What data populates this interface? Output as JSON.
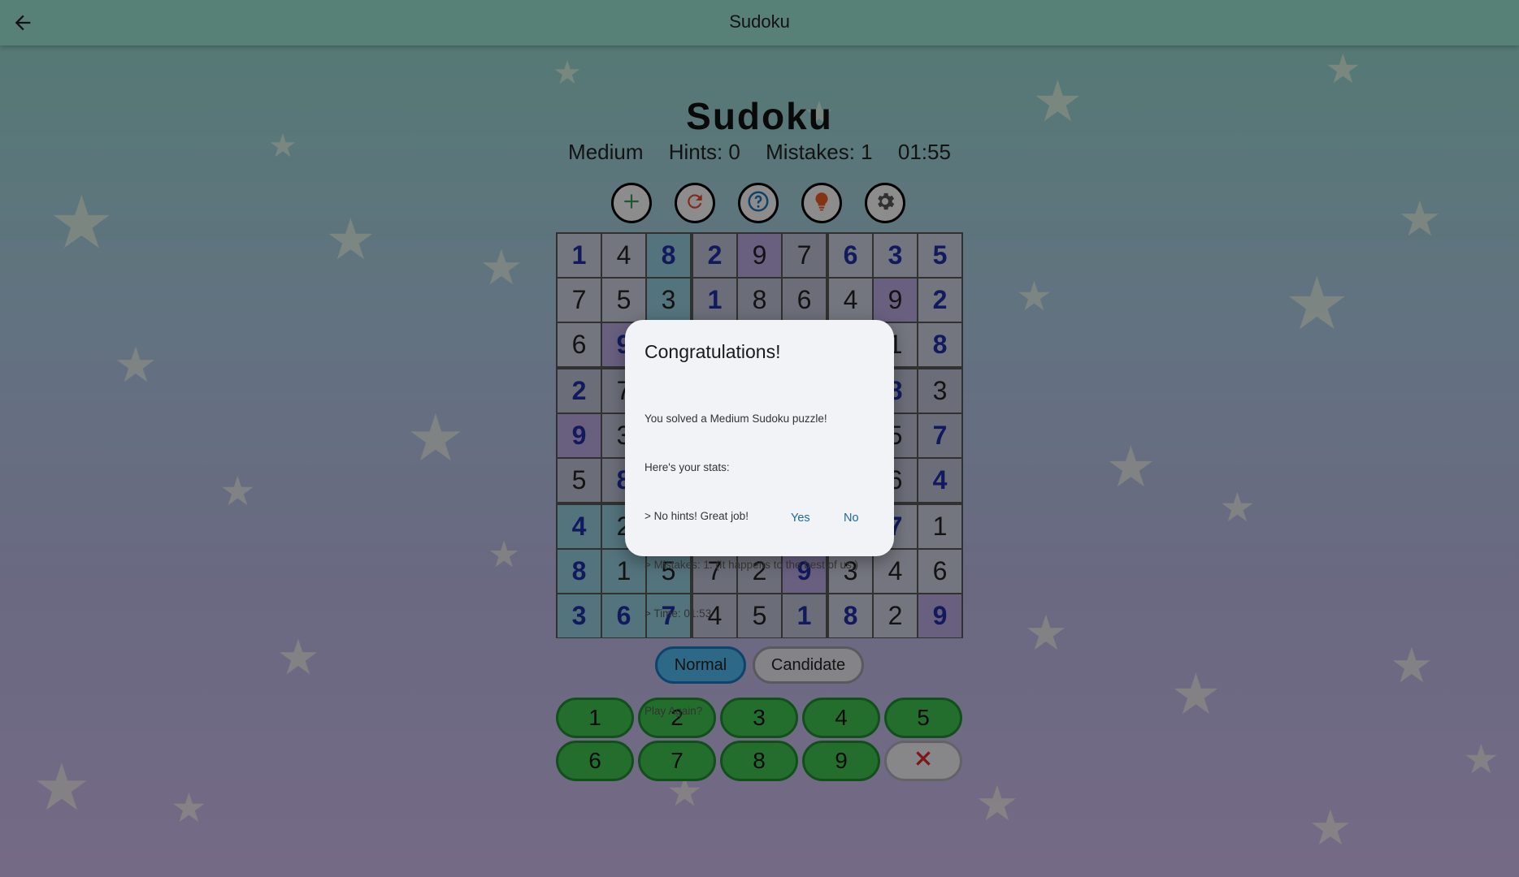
{
  "appbar": {
    "title": "Sudoku"
  },
  "game": {
    "title": "Sudoku",
    "difficulty": "Medium",
    "hints": "Hints: 0",
    "mistakes": "Mistakes: 1",
    "timer": "01:55"
  },
  "toolbar": [
    {
      "name": "new-game",
      "icon": "plus-icon",
      "color": "#2e9a47"
    },
    {
      "name": "restart",
      "icon": "refresh-icon",
      "color": "#e0472f"
    },
    {
      "name": "help",
      "icon": "question-icon",
      "color": "#1b74b8"
    },
    {
      "name": "hint",
      "icon": "lightbulb-icon",
      "color": "#e45a22"
    },
    {
      "name": "settings",
      "icon": "gear-icon",
      "color": "#555555"
    }
  ],
  "board": {
    "rows": [
      [
        "1",
        "4",
        "8",
        "2",
        "9",
        "7",
        "6",
        "3",
        "5"
      ],
      [
        "7",
        "5",
        "3",
        "1",
        "8",
        "6",
        "4",
        "9",
        "2"
      ],
      [
        "6",
        "9",
        "",
        "",
        "",
        "",
        "",
        "1",
        "8"
      ],
      [
        "2",
        "7",
        "",
        "",
        "",
        "",
        "",
        "8",
        "3"
      ],
      [
        "9",
        "3",
        "",
        "",
        "",
        "",
        "",
        "5",
        "7"
      ],
      [
        "5",
        "8",
        "",
        "",
        "",
        "",
        "",
        "6",
        "4"
      ],
      [
        "4",
        "2",
        "",
        "",
        "",
        "",
        "",
        "7",
        "1"
      ],
      [
        "8",
        "1",
        "5",
        "7",
        "2",
        "9",
        "3",
        "4",
        "6"
      ],
      [
        "3",
        "6",
        "7",
        "4",
        "5",
        "1",
        "8",
        "2",
        "9"
      ]
    ],
    "given": [
      [
        1,
        0,
        1,
        1,
        0,
        0,
        1,
        1,
        1
      ],
      [
        0,
        0,
        0,
        1,
        0,
        0,
        0,
        0,
        1
      ],
      [
        0,
        1,
        0,
        0,
        0,
        0,
        0,
        0,
        1
      ],
      [
        1,
        0,
        0,
        0,
        0,
        0,
        0,
        1,
        0
      ],
      [
        1,
        0,
        0,
        0,
        0,
        0,
        0,
        0,
        1
      ],
      [
        0,
        1,
        0,
        0,
        0,
        0,
        0,
        0,
        1
      ],
      [
        1,
        0,
        0,
        0,
        0,
        0,
        0,
        1,
        0
      ],
      [
        1,
        0,
        0,
        0,
        0,
        1,
        0,
        0,
        0
      ],
      [
        1,
        1,
        1,
        0,
        0,
        1,
        1,
        0,
        1
      ]
    ]
  },
  "modes": {
    "normal": "Normal",
    "candidate": "Candidate"
  },
  "numpad": [
    "1",
    "2",
    "3",
    "4",
    "5",
    "6",
    "7",
    "8",
    "9"
  ],
  "erase_icon": "close-icon",
  "dialog": {
    "title": "Congratulations!",
    "lines": [
      "You solved a Medium Sudoku puzzle!",
      "Here's your stats:",
      "> No hints! Great job!",
      "> Mistakes: 1. (It happens to the best of us.)",
      "> Time: 01:53",
      "",
      "Play Again?"
    ],
    "yes": "Yes",
    "no": "No"
  }
}
